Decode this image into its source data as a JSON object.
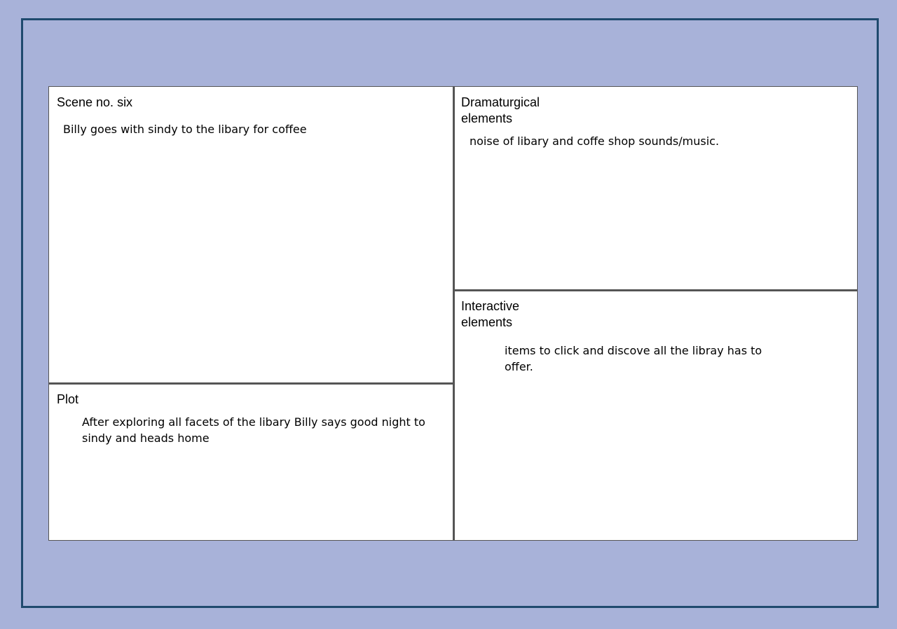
{
  "scene": {
    "title": "Scene no. six",
    "text": "Billy goes with sindy to the libary for coffee"
  },
  "plot": {
    "title": "Plot",
    "text": "After exploring all facets of the libary Billy says good night to sindy and heads home"
  },
  "dramaturgical": {
    "title": "Dramaturgical elements",
    "text": "noise of libary and coffe shop sounds/music."
  },
  "interactive": {
    "title": "Interactive elements",
    "text": "items to click and discove all the libray has to offer."
  },
  "colors": {
    "background": "#a8b2d9",
    "frame_border": "#1f4a6e",
    "card": "#ffffff",
    "divider": "#555555"
  }
}
